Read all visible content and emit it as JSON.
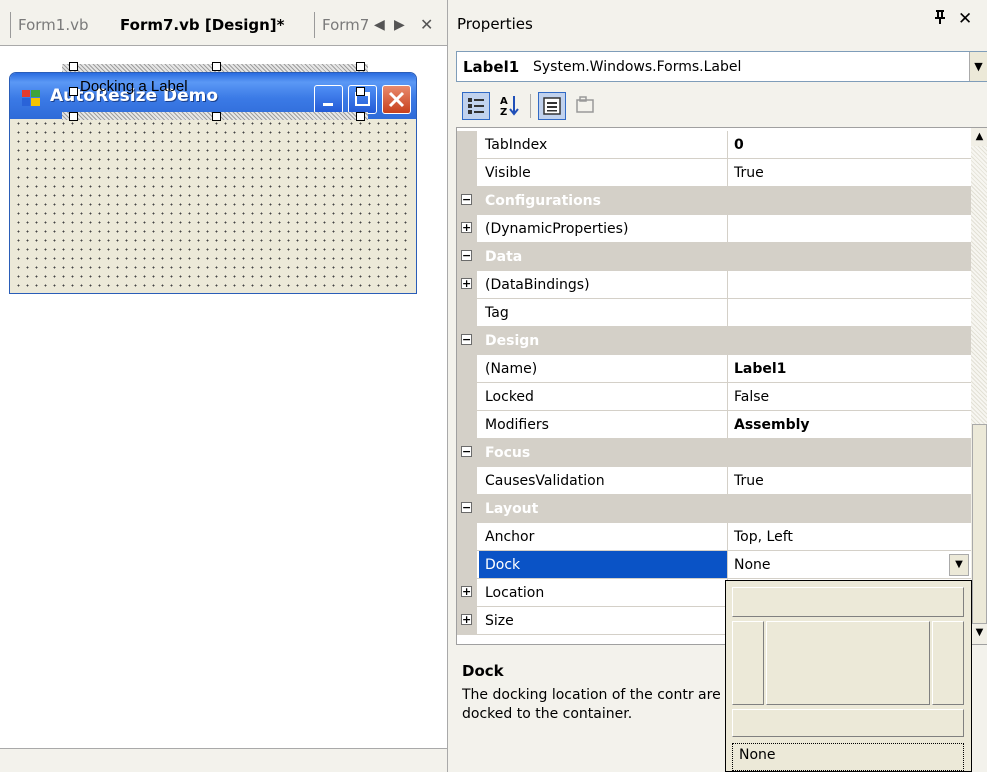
{
  "tabs": {
    "tab1": "Form1.vb",
    "tab2": "Form7.vb [Design]*",
    "tab3": "Form7",
    "nav_left": "◀",
    "nav_right": "▶",
    "close": "✕"
  },
  "form": {
    "title": "AutoResize  Demo",
    "label_text": "Docking a Label"
  },
  "properties": {
    "title": "Properties",
    "pin": "ᵽ",
    "close": "✕",
    "object_name": "Label1",
    "object_type": "System.Windows.Forms.Label",
    "rows": [
      {
        "kind": "prop",
        "name": "TabIndex",
        "value": "0",
        "bold": true
      },
      {
        "kind": "prop",
        "name": "Visible",
        "value": "True",
        "bold": false
      },
      {
        "kind": "cat",
        "name": "Configurations"
      },
      {
        "kind": "expand",
        "name": "(DynamicProperties)",
        "value": ""
      },
      {
        "kind": "cat",
        "name": "Data"
      },
      {
        "kind": "expand",
        "name": "(DataBindings)",
        "value": ""
      },
      {
        "kind": "prop",
        "name": "Tag",
        "value": "",
        "bold": false
      },
      {
        "kind": "cat",
        "name": "Design"
      },
      {
        "kind": "prop",
        "name": "(Name)",
        "value": "Label1",
        "bold": true
      },
      {
        "kind": "prop",
        "name": "Locked",
        "value": "False",
        "bold": false
      },
      {
        "kind": "prop",
        "name": "Modifiers",
        "value": "Assembly",
        "bold": true
      },
      {
        "kind": "cat",
        "name": "Focus"
      },
      {
        "kind": "prop",
        "name": "CausesValidation",
        "value": "True",
        "bold": false
      },
      {
        "kind": "cat",
        "name": "Layout"
      },
      {
        "kind": "prop",
        "name": "Anchor",
        "value": "Top, Left",
        "bold": false
      },
      {
        "kind": "selected",
        "name": "Dock",
        "value": "None",
        "bold": false
      },
      {
        "kind": "expand",
        "name": "Location",
        "value": ""
      },
      {
        "kind": "expand",
        "name": "Size",
        "value": ""
      }
    ],
    "desc_title": "Dock",
    "desc_text": "The docking location of the contr are docked to the container.",
    "dock_option_none": "None"
  },
  "colors": {
    "selection": "#0a53c6",
    "category_bg": "#d4d0c8",
    "xp_title": "#2f6bd8"
  }
}
